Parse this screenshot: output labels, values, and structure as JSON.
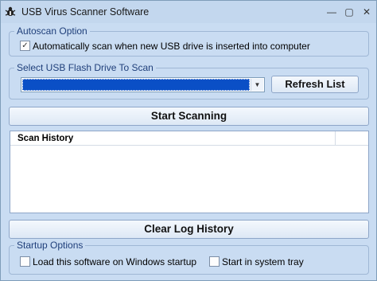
{
  "window": {
    "title": "USB Virus Scanner Software",
    "minimize_glyph": "—",
    "maximize_glyph": "▢",
    "close_glyph": "✕"
  },
  "autoscan": {
    "legend": "Autoscan Option",
    "checkbox_checked": true,
    "check_glyph": "✓",
    "label": "Automatically scan when new USB drive is inserted into computer"
  },
  "drive_select": {
    "legend": "Select USB Flash Drive To Scan",
    "selected_value": "",
    "arrow_glyph": "▼",
    "refresh_label": "Refresh List"
  },
  "scan": {
    "start_label": "Start Scanning"
  },
  "history": {
    "column_header": "Scan History",
    "rows": []
  },
  "log": {
    "clear_label": "Clear Log History"
  },
  "startup": {
    "legend": "Startup Options",
    "load_on_startup_label": "Load this software on Windows startup",
    "load_on_startup_checked": false,
    "start_in_tray_label": "Start in system tray",
    "start_in_tray_checked": false
  },
  "colors": {
    "window_bg": "#c9dcf2",
    "legend_text": "#1f3f7a",
    "selection_blue": "#0a4fc6"
  }
}
